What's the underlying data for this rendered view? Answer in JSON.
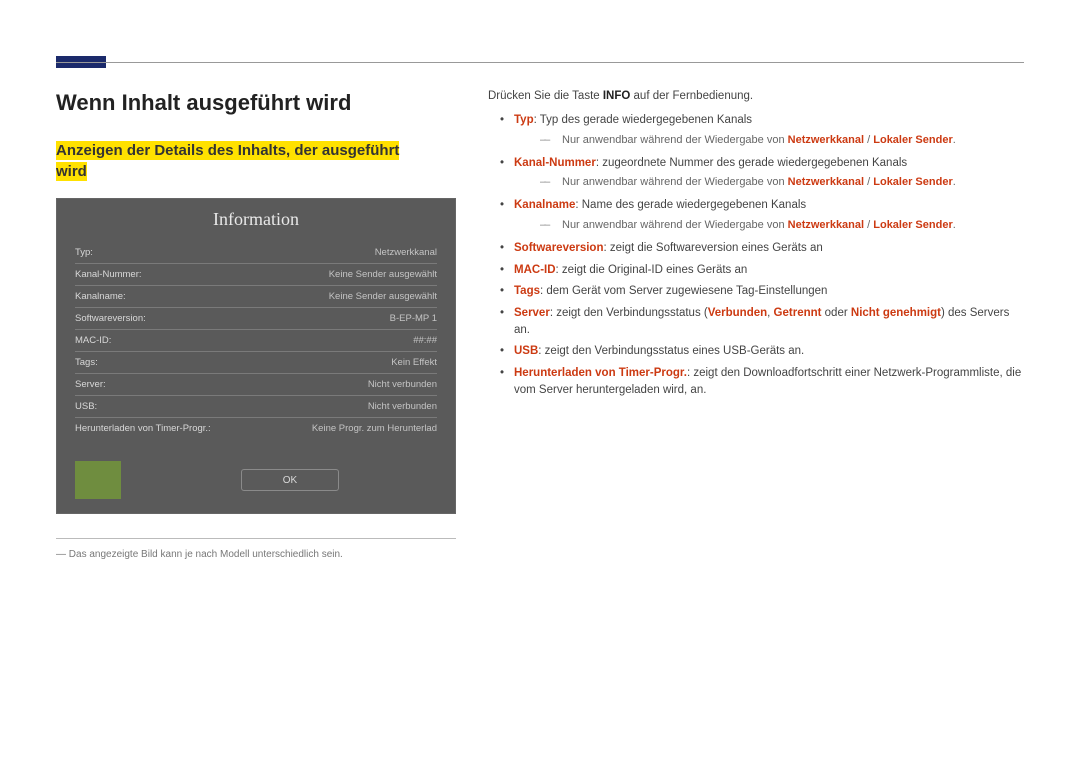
{
  "heading": "Wenn Inhalt ausgeführt wird",
  "subheading_l1": "Anzeigen der Details des Inhalts, der ausgeführt",
  "subheading_l2": "wird",
  "info_panel": {
    "title": "Information",
    "rows": [
      {
        "k": "Typ:",
        "v": "Netzwerkkanal"
      },
      {
        "k": "Kanal-Nummer:",
        "v": "Keine Sender ausgewählt"
      },
      {
        "k": "Kanalname:",
        "v": "Keine Sender ausgewählt"
      },
      {
        "k": "Softwareversion:",
        "v": "B-EP-MP 1"
      },
      {
        "k": "MAC-ID:",
        "v": "##:##"
      },
      {
        "k": "Tags:",
        "v": "Kein Effekt"
      },
      {
        "k": "Server:",
        "v": "Nicht verbunden"
      },
      {
        "k": "USB:",
        "v": "Nicht verbunden"
      },
      {
        "k": "Herunterladen von Timer-Progr.:",
        "v": "Keine Progr. zum Herunterlad"
      }
    ],
    "ok": "OK"
  },
  "footnote": "Das angezeigte Bild kann je nach Modell unterschiedlich sein.",
  "lead_a": "Drücken Sie die Taste ",
  "lead_key": "INFO",
  "lead_b": " auf der Fernbedienung.",
  "bullets": {
    "typ": {
      "term": "Typ",
      "text": ": Typ des gerade wiedergegebenen Kanals"
    },
    "note_a": "Nur anwendbar während der Wiedergabe von ",
    "note_b": " / ",
    "net": "Netzwerkkanal",
    "loc": "Lokaler Sender",
    "kanalnr": {
      "term": "Kanal-Nummer",
      "text": ": zugeordnete Nummer des gerade wiedergegebenen Kanals"
    },
    "kanalname": {
      "term": "Kanalname",
      "text": ": Name des gerade wiedergegebenen Kanals"
    },
    "softver": {
      "term": "Softwareversion",
      "text": ": zeigt die Softwareversion eines Geräts an"
    },
    "macid": {
      "term": "MAC-ID",
      "text": ": zeigt die Original-ID eines Geräts an"
    },
    "tags": {
      "term": "Tags",
      "text": ": dem Gerät vom Server zugewiesene Tag-Einstellungen"
    },
    "server": {
      "term": "Server",
      "a": ": zeigt den Verbindungsstatus (",
      "s1": "Verbunden",
      "sep": ", ",
      "s2": "Getrennt",
      "mid": " oder ",
      "s3": "Nicht genehmigt",
      "b": ") des Servers an."
    },
    "usb": {
      "term": "USB",
      "text": ": zeigt den Verbindungsstatus eines USB-Geräts an."
    },
    "dl": {
      "term": "Herunterladen von Timer-Progr.",
      "text": ": zeigt den Downloadfortschritt einer Netzwerk-Programmliste, die vom Server heruntergeladen wird, an."
    }
  },
  "dot": "."
}
